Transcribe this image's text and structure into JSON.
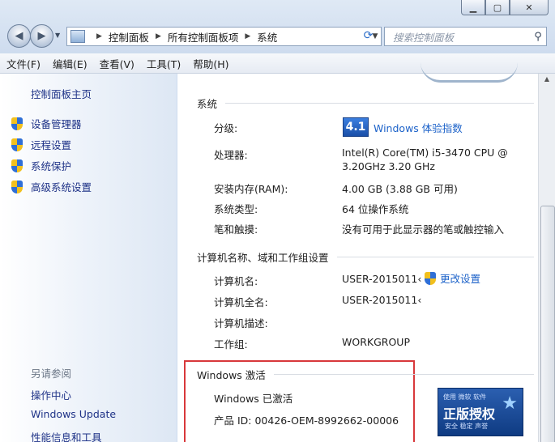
{
  "window": {
    "min_icon": "minimize-icon",
    "max_icon": "maximize-icon",
    "close_icon": "close-icon"
  },
  "address": {
    "crumbs": [
      "控制面板",
      "所有控制面板项",
      "系统"
    ],
    "search_placeholder": "搜索控制面板"
  },
  "menu": [
    "文件(F)",
    "编辑(E)",
    "查看(V)",
    "工具(T)",
    "帮助(H)"
  ],
  "left": {
    "home": "控制面板主页",
    "tasks": [
      "设备管理器",
      "远程设置",
      "系统保护",
      "高级系统设置"
    ],
    "see_also": "另请参阅",
    "links": [
      "操作中心",
      "Windows Update",
      "性能信息和工具"
    ]
  },
  "system": {
    "title": "系统",
    "rating_label": "分级:",
    "rating_score": "4.1",
    "rating_link": "Windows 体验指数",
    "cpu_label": "处理器:",
    "cpu_line1": "Intel(R) Core(TM) i5-3470 CPU @",
    "cpu_line2": "3.20GHz   3.20 GHz",
    "ram_label": "安装内存(RAM):",
    "ram_value": "4.00 GB (3.88 GB 可用)",
    "type_label": "系统类型:",
    "type_value": "64 位操作系统",
    "pen_label": "笔和触摸:",
    "pen_value": "没有可用于此显示器的笔或触控输入"
  },
  "computer": {
    "title": "计算机名称、域和工作组设置",
    "name_label": "计算机名:",
    "name_value": "USER-2015011‹",
    "fullname_label": "计算机全名:",
    "fullname_value": "USER-2015011‹",
    "desc_label": "计算机描述:",
    "wg_label": "工作组:",
    "wg_value": "WORKGROUP",
    "change_link": "更改设置"
  },
  "activation": {
    "title": "Windows 激活",
    "status": "Windows 已激活",
    "product_id": "产品 ID: 00426-OEM-8992662-00006",
    "genuine_top": "使用 微软 软件",
    "genuine_main": "正版授权",
    "genuine_bottom": "安全 稳定 声誉"
  },
  "colors": {
    "link": "#1c62c9",
    "nav_link": "#1e3287",
    "highlight_box": "#d8383b"
  }
}
